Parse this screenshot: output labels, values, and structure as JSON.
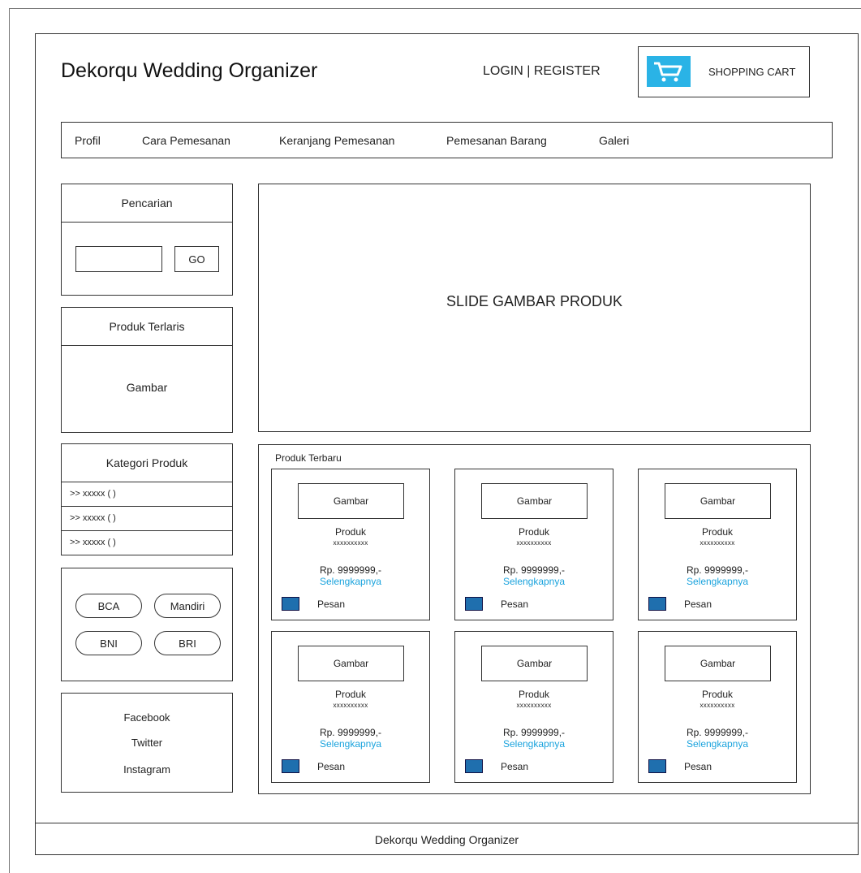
{
  "header": {
    "title": "Dekorqu Wedding Organizer",
    "login_register": "LOGIN | REGISTER",
    "cart_label": "SHOPPING CART",
    "cart_icon": "shopping-cart-icon",
    "cart_icon_color": "#2ab3e6"
  },
  "nav": {
    "items": [
      "Profil",
      "Cara Pemesanan",
      "Keranjang Pemesanan",
      "Pemesanan Barang",
      "Galeri"
    ]
  },
  "sidebar": {
    "search": {
      "title": "Pencarian",
      "input_value": "",
      "go_label": "GO"
    },
    "best_seller": {
      "title": "Produk Terlaris",
      "image_label": "Gambar"
    },
    "categories": {
      "title": "Kategori Produk",
      "items": [
        ">> xxxxx ( )",
        ">> xxxxx ( )",
        ">> xxxxx ( )"
      ]
    },
    "banks": [
      "BCA",
      "Mandiri",
      "BNI",
      "BRI"
    ],
    "social": [
      "Facebook",
      "Twitter",
      "Instagram"
    ]
  },
  "main": {
    "slide_label": "SLIDE GAMBAR PRODUK",
    "latest_title": "Produk Terbaru",
    "products": [
      {
        "image": "Gambar",
        "name": "Produk",
        "code": "xxxxxxxxxx",
        "price": "Rp. 9999999,-",
        "more": "Selengkapnya",
        "order": "Pesan"
      },
      {
        "image": "Gambar",
        "name": "Produk",
        "code": "xxxxxxxxxx",
        "price": "Rp. 9999999,-",
        "more": "Selengkapnya",
        "order": "Pesan"
      },
      {
        "image": "Gambar",
        "name": "Produk",
        "code": "xxxxxxxxxx",
        "price": "Rp. 9999999,-",
        "more": "Selengkapnya",
        "order": "Pesan"
      },
      {
        "image": "Gambar",
        "name": "Produk",
        "code": "xxxxxxxxxx",
        "price": "Rp. 9999999,-",
        "more": "Selengkapnya",
        "order": "Pesan"
      },
      {
        "image": "Gambar",
        "name": "Produk",
        "code": "xxxxxxxxxx",
        "price": "Rp. 9999999,-",
        "more": "Selengkapnya",
        "order": "Pesan"
      },
      {
        "image": "Gambar",
        "name": "Produk",
        "code": "xxxxxxxxxx",
        "price": "Rp. 9999999,-",
        "more": "Selengkapnya",
        "order": "Pesan"
      }
    ],
    "link_color": "#1aa3dd"
  },
  "footer": {
    "text": "Dekorqu Wedding Organizer"
  }
}
